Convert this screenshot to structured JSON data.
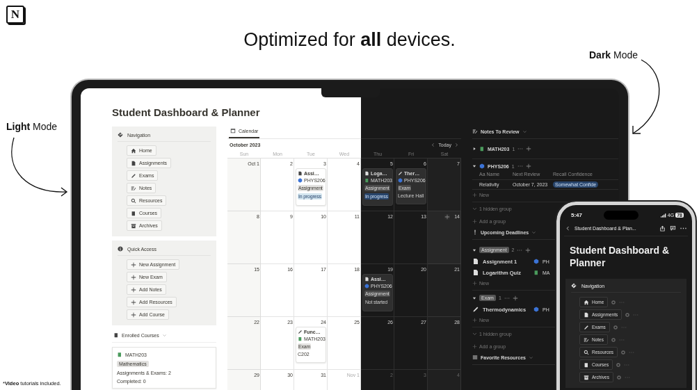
{
  "logo": {
    "letter": "N"
  },
  "headline": "Optimized for **all** devices.",
  "light_label": "**Light** Mode",
  "dark_label": "**Dark** Mode",
  "footnote": {
    "mark": "*",
    "emphasis": "Video",
    "text": " tutorials included."
  },
  "laptop": {
    "page_title": "Student Dashboard & Planner",
    "navigation": {
      "title": "Navigation",
      "items": [
        "Home",
        "Assignments",
        "Exams",
        "Notes",
        "Resources",
        "Courses",
        "Archives"
      ]
    },
    "quick_access": {
      "title": "Quick Access",
      "items": [
        "New Assignment",
        "New Exam",
        "Add Notes",
        "Add Resources",
        "Add Course"
      ]
    },
    "enrolled_courses": {
      "title": "Enrolled Courses",
      "card": {
        "name": "MATH203",
        "color": "#4a9a5c",
        "tag": "Mathematics",
        "lines": [
          "Assignments & Exams: 2",
          "Completed: 0"
        ]
      }
    },
    "calendar": {
      "tab": "Calendar",
      "tab_selected": true,
      "month": "October 2023",
      "today": "Today",
      "weekdays": [
        "Sun",
        "Mon",
        "Tue",
        "Wed",
        "Thu",
        "Fri",
        "Sat"
      ],
      "weeks": [
        [
          {
            "label": "Oct 1",
            "muted": false,
            "hovered": false
          },
          {
            "label": "2",
            "muted": false,
            "hovered": false
          },
          {
            "label": "3",
            "muted": false,
            "hovered": false,
            "events": [
              {
                "kind": "assignment",
                "title": "Assi…",
                "course": "PHYS206",
                "color": "#3b73d6",
                "tag": "Assignment",
                "status": "In progress",
                "status_active": true
              }
            ]
          },
          {
            "label": "4",
            "muted": false,
            "hovered": false
          },
          {
            "label": "5",
            "muted": false,
            "hovered": false,
            "events": [
              {
                "kind": "assignment",
                "title": "Loga…",
                "course": "MATH203",
                "color": "#4a9a5c",
                "tag": "Assignment",
                "status": "In progress",
                "status_active": true
              }
            ]
          },
          {
            "label": "6",
            "muted": false,
            "hovered": false,
            "events": [
              {
                "kind": "exam",
                "title": "Ther…",
                "course": "PHYS206",
                "color": "#3b73d6",
                "tag": "Exam",
                "note": "Lecture Hall"
              }
            ]
          },
          {
            "label": "7",
            "muted": false,
            "hovered": false
          }
        ],
        [
          {
            "label": "8",
            "muted": false,
            "hovered": false
          },
          {
            "label": "9",
            "muted": false,
            "hovered": false
          },
          {
            "label": "10",
            "muted": false,
            "hovered": false
          },
          {
            "label": "11",
            "muted": false,
            "hovered": false
          },
          {
            "label": "12",
            "muted": false,
            "hovered": false
          },
          {
            "label": "13",
            "muted": false,
            "hovered": false
          },
          {
            "label": "14",
            "muted": false,
            "hovered": true
          }
        ],
        [
          {
            "label": "15",
            "muted": false,
            "hovered": false
          },
          {
            "label": "16",
            "muted": false,
            "hovered": false
          },
          {
            "label": "17",
            "muted": false,
            "hovered": false
          },
          {
            "label": "18",
            "muted": false,
            "hovered": false
          },
          {
            "label": "19",
            "muted": false,
            "hovered": false,
            "events": [
              {
                "kind": "assignment",
                "title": "Assi…",
                "course": "PHYS206",
                "color": "#3b73d6",
                "tag": "Assignment",
                "status": "Not started",
                "status_active": false
              }
            ]
          },
          {
            "label": "20",
            "muted": false,
            "hovered": false
          },
          {
            "label": "21",
            "muted": false,
            "hovered": false
          }
        ],
        [
          {
            "label": "22",
            "muted": false,
            "hovered": false
          },
          {
            "label": "23",
            "muted": false,
            "hovered": false
          },
          {
            "label": "24",
            "muted": false,
            "hovered": false,
            "events": [
              {
                "kind": "exam",
                "title": "Func…",
                "course": "MATH203",
                "color": "#4a9a5c",
                "tag": "Exam",
                "note": "C202"
              }
            ]
          },
          {
            "label": "25",
            "muted": false,
            "hovered": false
          },
          {
            "label": "26",
            "muted": false,
            "hovered": false
          },
          {
            "label": "27",
            "muted": false,
            "hovered": false
          },
          {
            "label": "28",
            "muted": false,
            "hovered": false
          }
        ],
        [
          {
            "label": "29",
            "muted": false,
            "hovered": false
          },
          {
            "label": "30",
            "muted": false,
            "hovered": false
          },
          {
            "label": "31",
            "muted": false,
            "hovered": false
          },
          {
            "label": "Nov 1",
            "muted": true,
            "hovered": false
          },
          {
            "label": "2",
            "muted": true,
            "hovered": false
          },
          {
            "label": "3",
            "muted": true,
            "hovered": false
          },
          {
            "label": "4",
            "muted": true,
            "hovered": false
          }
        ]
      ]
    },
    "notes_to_review": {
      "title": "Notes To Review",
      "groups": [
        {
          "name": "MATH203",
          "color": "#4a9a5c",
          "count": "1",
          "expanded": false
        },
        {
          "name": "PHYS206",
          "color": "#3b73d6",
          "count": "1",
          "expanded": true,
          "columns": [
            "Aa Name",
            "Next Review",
            "Recall Confidence"
          ],
          "rows": [
            {
              "name": "Relativity",
              "date": "October 7, 2023",
              "confidence": "Somewhat Confide"
            }
          ],
          "new": "New"
        }
      ],
      "hidden": "1 hidden group",
      "add_group": "Add a group"
    },
    "upcoming_deadlines": {
      "title": "Upcoming Deadlines",
      "groups": [
        {
          "tag": "Assignment",
          "count": "2",
          "expanded": true,
          "items": [
            {
              "kind": "assignment",
              "name": "Assignment 1",
              "course": "PH",
              "color": "#3b73d6"
            },
            {
              "kind": "assignment",
              "name": "Logarithm Quiz",
              "course": "MA",
              "color": "#4a9a5c"
            }
          ],
          "new": "New"
        },
        {
          "tag": "Exam",
          "count": "1",
          "expanded": true,
          "items": [
            {
              "kind": "exam",
              "name": "Thermodynamics",
              "course": "PH",
              "color": "#3b73d6"
            }
          ],
          "new": "New"
        }
      ],
      "hidden": "1 hidden group",
      "add_group": "Add a group"
    },
    "favorite_resources": {
      "title": "Favorite Resources"
    }
  },
  "phone": {
    "time": "5:47",
    "network": "4G",
    "battery": "78",
    "nav_title": "Student Dashboard & Plan...",
    "page_title": "Student Dashboard & Planner",
    "navigation": {
      "title": "Navigation",
      "items": [
        "Home",
        "Assignments",
        "Exams",
        "Notes",
        "Resources",
        "Courses",
        "Archives"
      ]
    }
  }
}
